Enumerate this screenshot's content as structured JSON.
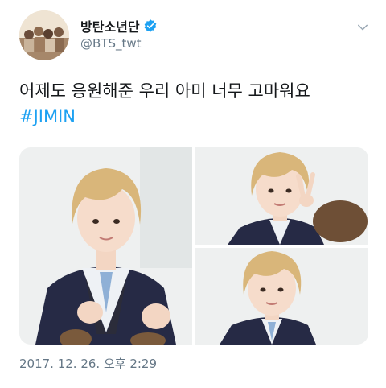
{
  "tweet": {
    "display_name": "방탄소년단",
    "handle": "@BTS_twt",
    "verified": true,
    "text": "어제도 응원해준 우리 아미 너무 고마워요",
    "hashtag": "#JIMIN",
    "timestamp": "2017. 12. 26. 오후 2:29",
    "media_count": 3
  },
  "icons": {
    "verified": "verified-badge-icon",
    "menu": "chevron-down-icon"
  },
  "colors": {
    "link": "#1da1f2",
    "secondary_text": "#657786",
    "verified": "#1da1f2"
  }
}
